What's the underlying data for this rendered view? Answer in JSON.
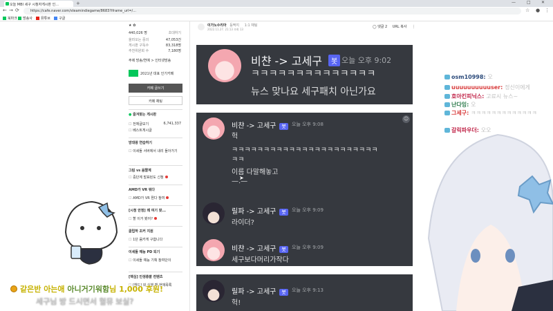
{
  "browser": {
    "tab_title": "오늘 MBI 세구 시청자게시판 인...",
    "url": "https://cafe.naver.com/steamindiegame/8683?iframe_url=/...",
    "bookmarks": [
      "북마크",
      "방송사",
      "뮤튜브",
      "구글"
    ]
  },
  "sidebar": {
    "member_count": "440,026 명",
    "invite_label": "초대하기",
    "stats": [
      {
        "label": "올라오는 중의",
        "value": "47,053건"
      },
      {
        "label": "게시판 구독수",
        "value": "83,318명"
      },
      {
        "label": "추천위원회 수",
        "value": "7,180명"
      }
    ],
    "theme_line": "주제 방송/연예 > 인터넷방송",
    "badge_text": "2021년 대표 인기카페",
    "write_button": "카페 글쓰기",
    "chat_button": "카페 채팅",
    "favorites_title": "즐겨찾는 게시판",
    "boards": [
      {
        "label": "전체글보기",
        "value": "6,741,337"
      },
      {
        "label": "베스트게시글",
        "value": ""
      }
    ],
    "sections": [
      {
        "title": "방대왕 연습하기",
        "item": "이세돌 서버에서 내리 돌아가기"
      },
      {
        "title": "그림 vs 움짤계",
        "item": "중단계 발표된도 신청"
      },
      {
        "title": "AMD가 VR 뭐다",
        "item": "AMD가 VR 뭔다 참여"
      },
      {
        "title": "[시청 안정] 왜 여기 찾...",
        "item": "할 이거 봤어?"
      },
      {
        "title": "클립하 조커 지원",
        "item": "1단 움카게 구합니다"
      },
      {
        "title": "이세돌 예능 PD 되기",
        "item": "이세돌 예능 기획 참여단이"
      },
      {
        "title": "[핵심] 인생총괄 컨텐츠",
        "item": "[헤드] 외 실행 팬 현재목록"
      }
    ]
  },
  "article": {
    "author": "이가노수리아",
    "author_tag": "등짝지",
    "author_grade": "1:1 채팅",
    "meta": "2022.11.27. 21:13  조회 13",
    "comment_label": "댓글 2",
    "url_copy_label": "URL 복사"
  },
  "discord_top": {
    "name": "비챤 -> 고세구",
    "bot": "봇",
    "time": "오늘 오후 9:02",
    "lines": [
      "ㅋㅋㅋㅋㅋㅋㅋㅋㅋㅋㅋㅋㅋㅋ",
      "뉴스 맞나요 세구패치 아닌가요"
    ]
  },
  "discord_messages": [
    {
      "name": "비챤 -> 고세구",
      "bot": "봇",
      "time": "오늘 오후 9:08",
      "lines": [
        "헉",
        "ㅋㅋㅋㅋㅋㅋㅋㅋㅋㅋㅋㅋㅋㅋㅋㅋㅋㅋㅋㅋㅋㅋㅋ",
        "ㅋㅋ",
        "이름 다말해놓고",
        "—.—"
      ]
    },
    {
      "name": "릴파 -> 고세구",
      "bot": "봇",
      "time": "오늘 오후 9:09",
      "lines": [
        "라이더?"
      ]
    },
    {
      "name": "비챤 -> 고세구",
      "bot": "봇",
      "time": "오늘 오후 9:09",
      "lines": [
        "세구보다머리가작다"
      ]
    },
    {
      "name": "릴파 -> 고세구",
      "bot": "봇",
      "time": "오늘 오후 9:13",
      "lines": [
        "헉!"
      ]
    }
  ],
  "chat": [
    {
      "user": "osm10998:",
      "msg": "오",
      "color": "#2b4a7a"
    },
    {
      "user": "uuuuuuuuuuser:",
      "msg": "정신이에게",
      "color": "#d83b3b"
    },
    {
      "user": "호아킨피닉스:",
      "msg": "고료시 뉴스~",
      "color": "#c1264a"
    },
    {
      "user": "난다잉:",
      "msg": "오",
      "color": "#2b7a4a"
    },
    {
      "user": "그세구:",
      "msg": "ㅋㅋㅋㅋㅋㅋㅋㅋㅋㅋㅋㅋㅋ",
      "color": "#d83b3b"
    },
    {
      "user": "갈릭파우더:",
      "msg": "오오",
      "color": "#c1264a"
    }
  ],
  "donation": {
    "pre": "같은반 아는애 ",
    "name": "아니거기워함",
    "post": "님 1,000 후원!",
    "message": "세구님 방 드시면서 혈뮤 보실?"
  }
}
